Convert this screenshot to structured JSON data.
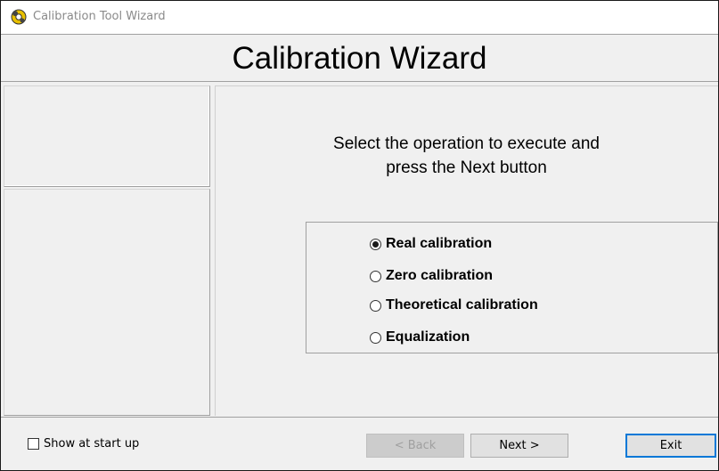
{
  "window": {
    "title": "Calibration Tool Wizard",
    "icon": "gear-wrench-icon"
  },
  "header": {
    "title": "Calibration Wizard"
  },
  "main": {
    "instruction_line1": "Select the operation to execute and",
    "instruction_line2": "press the Next button",
    "options": [
      {
        "label": "Real calibration",
        "selected": true
      },
      {
        "label": "Zero calibration",
        "selected": false
      },
      {
        "label": "Theoretical calibration",
        "selected": false
      },
      {
        "label": "Equalization",
        "selected": false
      }
    ]
  },
  "footer": {
    "show_at_startup_label": "Show at start up",
    "show_at_startup_checked": false,
    "back_label": "< Back",
    "back_enabled": false,
    "next_label": "Next >",
    "exit_label": "Exit"
  },
  "colors": {
    "default_button_border": "#0078d7",
    "dialog_background": "#f0f0f0"
  }
}
